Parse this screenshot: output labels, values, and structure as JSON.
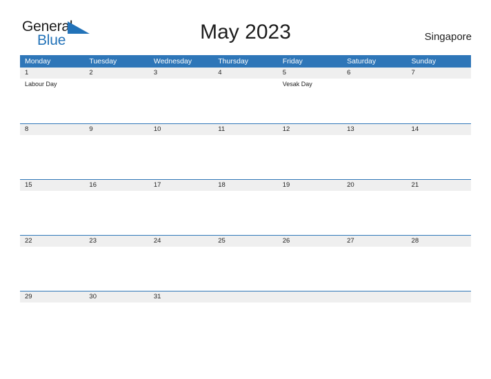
{
  "brand": {
    "name_part1": "General",
    "name_part2": "Blue",
    "triangle_icon": "triangle-logo-icon",
    "color_primary": "#2272b8"
  },
  "header": {
    "title": "May 2023",
    "locale": "Singapore"
  },
  "theme": {
    "header_blue": "#2e76b8",
    "date_band_gray": "#efefef",
    "text_dark": "#222222",
    "white": "#ffffff"
  },
  "calendar": {
    "month": "May",
    "year": "2023",
    "weekdays": [
      "Monday",
      "Tuesday",
      "Wednesday",
      "Thursday",
      "Friday",
      "Saturday",
      "Sunday"
    ],
    "weeks": [
      {
        "days": [
          {
            "date": "1",
            "events": [
              "Labour Day"
            ]
          },
          {
            "date": "2",
            "events": []
          },
          {
            "date": "3",
            "events": []
          },
          {
            "date": "4",
            "events": []
          },
          {
            "date": "5",
            "events": [
              "Vesak Day"
            ]
          },
          {
            "date": "6",
            "events": []
          },
          {
            "date": "7",
            "events": []
          }
        ]
      },
      {
        "days": [
          {
            "date": "8",
            "events": []
          },
          {
            "date": "9",
            "events": []
          },
          {
            "date": "10",
            "events": []
          },
          {
            "date": "11",
            "events": []
          },
          {
            "date": "12",
            "events": []
          },
          {
            "date": "13",
            "events": []
          },
          {
            "date": "14",
            "events": []
          }
        ]
      },
      {
        "days": [
          {
            "date": "15",
            "events": []
          },
          {
            "date": "16",
            "events": []
          },
          {
            "date": "17",
            "events": []
          },
          {
            "date": "18",
            "events": []
          },
          {
            "date": "19",
            "events": []
          },
          {
            "date": "20",
            "events": []
          },
          {
            "date": "21",
            "events": []
          }
        ]
      },
      {
        "days": [
          {
            "date": "22",
            "events": []
          },
          {
            "date": "23",
            "events": []
          },
          {
            "date": "24",
            "events": []
          },
          {
            "date": "25",
            "events": []
          },
          {
            "date": "26",
            "events": []
          },
          {
            "date": "27",
            "events": []
          },
          {
            "date": "28",
            "events": []
          }
        ]
      },
      {
        "days": [
          {
            "date": "29",
            "events": []
          },
          {
            "date": "30",
            "events": []
          },
          {
            "date": "31",
            "events": []
          },
          {
            "date": "",
            "events": []
          },
          {
            "date": "",
            "events": []
          },
          {
            "date": "",
            "events": []
          },
          {
            "date": "",
            "events": []
          }
        ]
      }
    ]
  }
}
